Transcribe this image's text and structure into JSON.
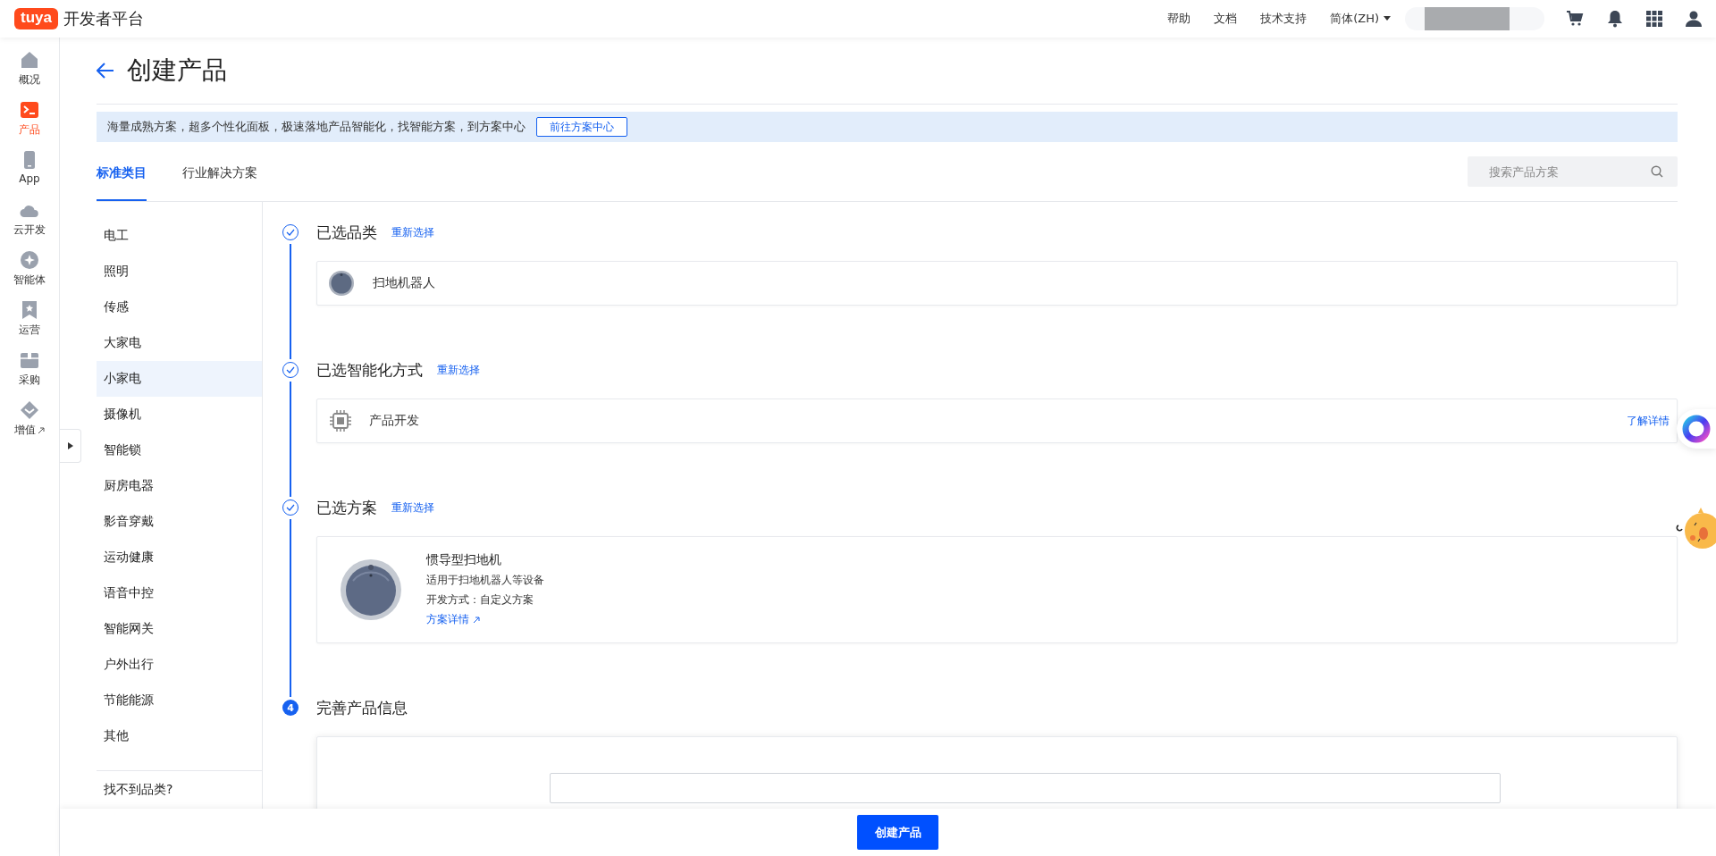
{
  "header": {
    "logo": "tuya",
    "title": "开发者平台",
    "links": [
      {
        "label": "帮助"
      },
      {
        "label": "文档"
      },
      {
        "label": "技术支持"
      }
    ],
    "language": "简体(ZH)"
  },
  "nav": [
    {
      "label": "概况",
      "selected": false,
      "external": false
    },
    {
      "label": "产品",
      "selected": true,
      "external": false
    },
    {
      "label": "App",
      "selected": false,
      "external": false
    },
    {
      "label": "云开发",
      "selected": false,
      "external": false
    },
    {
      "label": "智能体",
      "selected": false,
      "external": false
    },
    {
      "label": "运营",
      "selected": false,
      "external": false
    },
    {
      "label": "采购",
      "selected": false,
      "external": false
    },
    {
      "label": "增值",
      "selected": false,
      "external": true
    }
  ],
  "page": {
    "title": "创建产品"
  },
  "banner": {
    "text": "海量成熟方案，超多个性化面板，极速落地产品智能化，找智能方案，到方案中心",
    "button": "前往方案中心"
  },
  "tabs": [
    {
      "label": "标准类目",
      "selected": true
    },
    {
      "label": "行业解决方案",
      "selected": false
    }
  ],
  "search": {
    "placeholder": "搜索产品方案"
  },
  "categories": [
    {
      "label": "电工",
      "selected": false
    },
    {
      "label": "照明",
      "selected": false
    },
    {
      "label": "传感",
      "selected": false
    },
    {
      "label": "大家电",
      "selected": false
    },
    {
      "label": "小家电",
      "selected": true
    },
    {
      "label": "摄像机",
      "selected": false
    },
    {
      "label": "智能锁",
      "selected": false
    },
    {
      "label": "厨房电器",
      "selected": false
    },
    {
      "label": "影音穿戴",
      "selected": false
    },
    {
      "label": "运动健康",
      "selected": false
    },
    {
      "label": "语音中控",
      "selected": false
    },
    {
      "label": "智能网关",
      "selected": false
    },
    {
      "label": "户外出行",
      "selected": false
    },
    {
      "label": "节能能源",
      "selected": false
    },
    {
      "label": "其他",
      "selected": false
    }
  ],
  "category_footer": "找不到品类?",
  "steps": [
    {
      "done": true,
      "title": "已选品类",
      "action": "重新选择",
      "card": {
        "kind": "category",
        "name": "扫地机器人"
      }
    },
    {
      "done": true,
      "title": "已选智能化方式",
      "action": "重新选择",
      "card": {
        "kind": "method",
        "name": "产品开发",
        "link": "了解详情"
      }
    },
    {
      "done": true,
      "title": "已选方案",
      "action": "重新选择",
      "card": {
        "kind": "solution",
        "name": "惯导型扫地机",
        "lines": [
          "适用于扫地机器人等设备",
          "开发方式：自定义方案"
        ],
        "link": "方案详情"
      }
    },
    {
      "done": false,
      "number": "4",
      "title": "完善产品信息",
      "card": {
        "kind": "form"
      }
    }
  ],
  "footer_button": "创建产品"
}
